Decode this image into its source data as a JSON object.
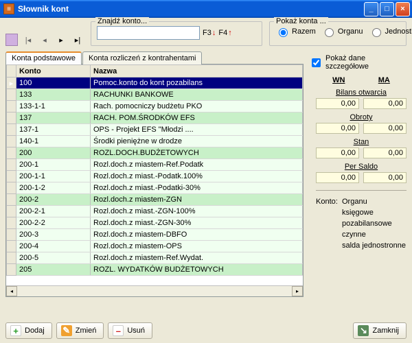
{
  "window": {
    "title": "Słownik kont"
  },
  "toolbar": {
    "search_legend": "Znajdź konto...",
    "search_value": "",
    "f3": "F3",
    "f4": "F4",
    "show_legend": "Pokaż konta ...",
    "radios": {
      "razem": "Razem",
      "organu": "Organu",
      "jednostki": "Jednostki"
    }
  },
  "tabs": {
    "basic": "Konta podstawowe",
    "contractors": "Konta rozliczeń z kontrahentami"
  },
  "grid": {
    "headers": {
      "konto": "Konto",
      "nazwa": "Nazwa"
    },
    "rows": [
      {
        "k": "100",
        "n": "Pomoc.konto do kont pozabilans",
        "cls": "sel",
        "ptr": "▸"
      },
      {
        "k": "133",
        "n": "RACHUNKI BANKOWE",
        "cls": "alt"
      },
      {
        "k": "133-1-1",
        "n": "Rach. pomocniczy budżetu PKO",
        "cls": "norm"
      },
      {
        "k": "137",
        "n": "RACH. POM.ŚRODKÓW  EFS",
        "cls": "alt"
      },
      {
        "k": "137-1",
        "n": "OPS - Projekt EFS \"Młodzi ....",
        "cls": "norm"
      },
      {
        "k": "140-1",
        "n": "Środki pieniężne w drodze",
        "cls": "norm"
      },
      {
        "k": "200",
        "n": "ROZL.DOCH.BUDŻETOWYCH",
        "cls": "alt"
      },
      {
        "k": "200-1",
        "n": "Rozl.doch.z miastem-Ref.Podatk",
        "cls": "norm"
      },
      {
        "k": "200-1-1",
        "n": "Rozl.doch.z miast.-Podatk.100%",
        "cls": "norm"
      },
      {
        "k": "200-1-2",
        "n": "Rozl.doch.z miast.-Podatki-30%",
        "cls": "norm"
      },
      {
        "k": "200-2",
        "n": "Rozl.doch.z miastem-ZGN",
        "cls": "alt"
      },
      {
        "k": "200-2-1",
        "n": "Rozl.doch.z miast.-ZGN-100%",
        "cls": "norm"
      },
      {
        "k": "200-2-2",
        "n": "Rozl.doch.z miast.-ZGN-30%",
        "cls": "norm"
      },
      {
        "k": "200-3",
        "n": "Rozl.doch.z miastem-DBFO",
        "cls": "norm"
      },
      {
        "k": "200-4",
        "n": "Rozl.doch.z miastem-OPS",
        "cls": "norm"
      },
      {
        "k": "200-5",
        "n": "Rozl.doch.z miastem-Ref.Wydat.",
        "cls": "norm"
      },
      {
        "k": "205",
        "n": "ROZL. WYDATKÓW BUDŻETOWYCH",
        "cls": "alt"
      }
    ]
  },
  "details": {
    "show_details": "Pokaż dane szczegółowe",
    "wn": "WN",
    "ma": "MA",
    "sections": {
      "bilans": {
        "label": "Bilans otwarcia",
        "wn": "0,00",
        "ma": "0,00"
      },
      "obroty": {
        "label": "Obroty",
        "wn": "0,00",
        "ma": "0,00"
      },
      "stan": {
        "label": "Stan",
        "wn": "0,00",
        "ma": "0,00"
      },
      "persaldo": {
        "label": "Per Saldo",
        "wn": "0,00",
        "ma": "0,00"
      }
    },
    "konto_label": "Konto:",
    "info": [
      "Organu",
      "księgowe",
      "pozabilansowe",
      "czynne",
      "salda jednostronne"
    ]
  },
  "buttons": {
    "add": "Dodaj",
    "edit": "Zmień",
    "del": "Usuń",
    "close": "Zamknij"
  }
}
